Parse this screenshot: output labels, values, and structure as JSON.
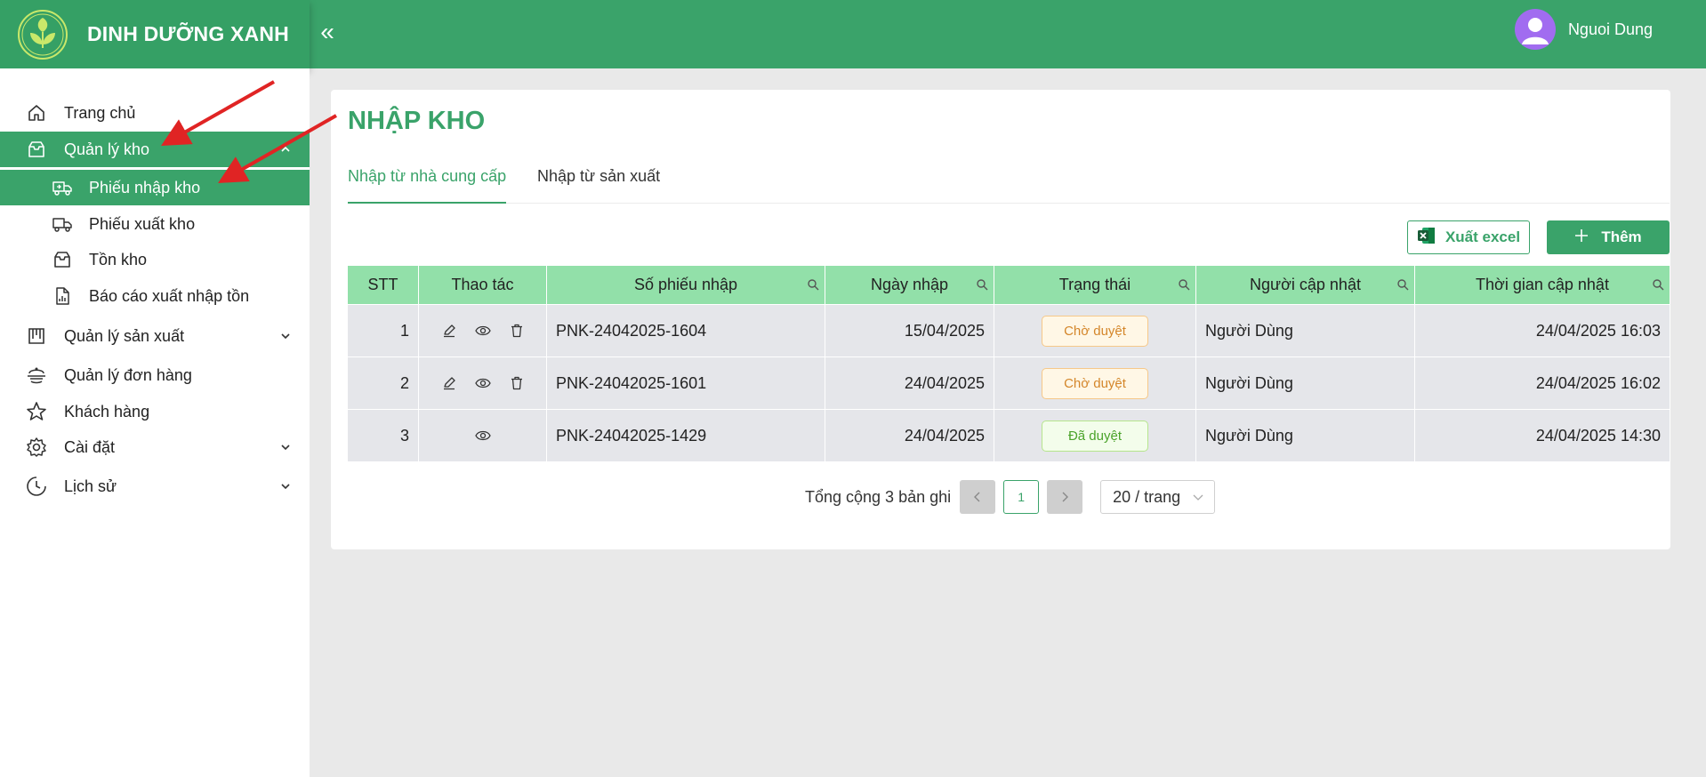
{
  "app": {
    "brand_name": "DINH DƯỠNG XANH",
    "collapse_glyph": "«",
    "user_name": "Nguoi Dung",
    "accent_color": "#3aa36a"
  },
  "sidebar": {
    "items": [
      {
        "label": "Trang chủ",
        "icon": "home-icon"
      },
      {
        "label": "Quản lý kho",
        "icon": "inbox-icon",
        "expanded": true,
        "active": true
      },
      {
        "label": "Phiếu nhập kho",
        "icon": "truck-in-icon",
        "sub": true,
        "selected": true
      },
      {
        "label": "Phiếu xuất kho",
        "icon": "truck-out-icon",
        "sub": true
      },
      {
        "label": "Tồn kho",
        "icon": "inbox-icon",
        "sub": true
      },
      {
        "label": "Báo cáo xuất nhập tồn",
        "icon": "report-icon",
        "sub": true
      },
      {
        "label": "Quản lý sản xuất",
        "icon": "factory-icon",
        "expandable": true
      },
      {
        "label": "Quản lý đơn hàng",
        "icon": "order-icon"
      },
      {
        "label": "Khách hàng",
        "icon": "star-icon"
      },
      {
        "label": "Cài đặt",
        "icon": "gear-icon",
        "expandable": true
      },
      {
        "label": "Lịch sử",
        "icon": "history-icon",
        "expandable": true
      }
    ]
  },
  "main": {
    "title": "NHẬP KHO",
    "tabs": [
      {
        "label": "Nhập từ nhà cung cấp",
        "active": true
      },
      {
        "label": "Nhập từ sản xuất",
        "active": false
      }
    ],
    "export_label": "Xuất excel",
    "add_label": "Thêm",
    "table": {
      "columns": [
        "STT",
        "Thao tác",
        "Số phiếu nhập",
        "Ngày nhập",
        "Trạng thái",
        "Người cập nhật",
        "Thời gian cập nhật"
      ],
      "rows": [
        {
          "stt": "1",
          "code": "PNK-24042025-1604",
          "date": "15/04/2025",
          "status": "Chờ duyệt",
          "status_type": "pending",
          "user": "Người Dùng",
          "updated": "24/04/2025 16:03",
          "actions": [
            "edit",
            "view",
            "delete"
          ]
        },
        {
          "stt": "2",
          "code": "PNK-24042025-1601",
          "date": "24/04/2025",
          "status": "Chờ duyệt",
          "status_type": "pending",
          "user": "Người Dùng",
          "updated": "24/04/2025 16:02",
          "actions": [
            "edit",
            "view",
            "delete"
          ]
        },
        {
          "stt": "3",
          "code": "PNK-24042025-1429",
          "date": "24/04/2025",
          "status": "Đã duyệt",
          "status_type": "done",
          "user": "Người Dùng",
          "updated": "24/04/2025 14:30",
          "actions": [
            "view"
          ]
        }
      ]
    },
    "pagination": {
      "total_text": "Tổng cộng 3 bản ghi",
      "current_page": "1",
      "page_size": "20 / trang"
    }
  }
}
